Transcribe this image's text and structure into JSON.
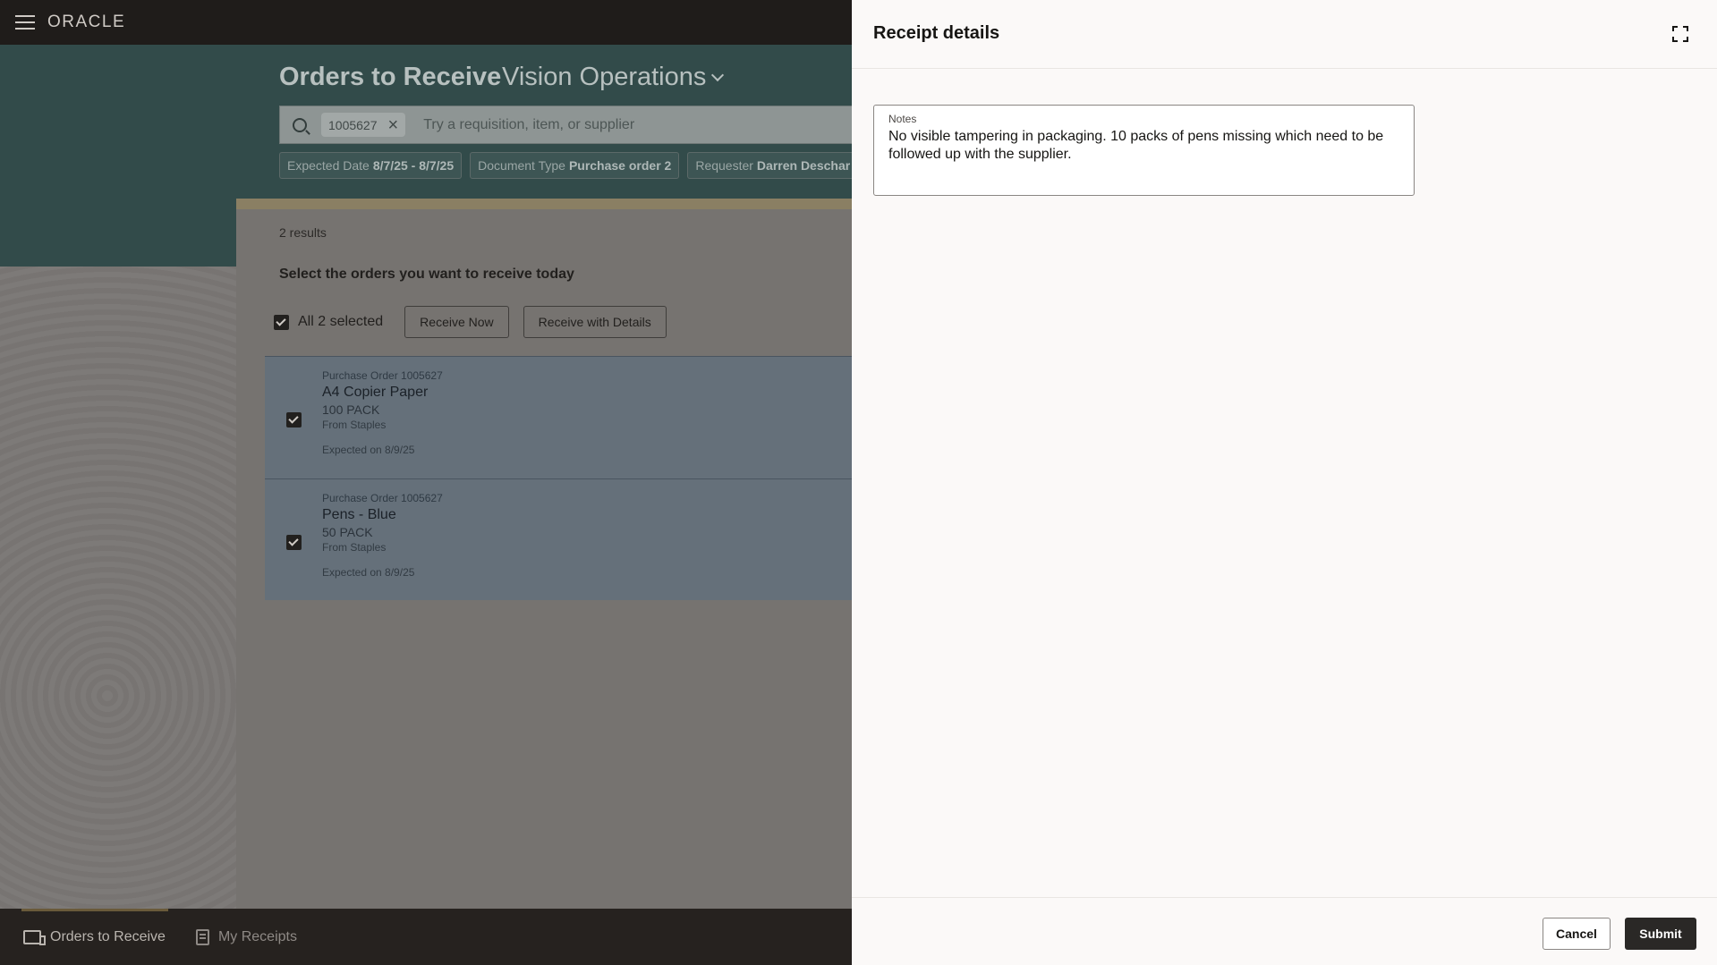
{
  "app": {
    "logo": "ORACLE",
    "page_title": "Orders to Receive",
    "org": "Vision Operations"
  },
  "search": {
    "chip": "1005627",
    "placeholder": "Try a requisition, item, or supplier"
  },
  "filters": [
    {
      "label": "Expected Date",
      "value": "8/7/25 - 8/7/25"
    },
    {
      "label": "Document Type",
      "value": "Purchase order  2"
    },
    {
      "label": "Requester",
      "value": "Darren Deschar"
    }
  ],
  "results": {
    "count": "2 results",
    "heading": "Select the orders you want to receive today",
    "select_all": "All 2 selected",
    "receive_now": "Receive Now",
    "receive_details": "Receive with Details"
  },
  "orders": [
    {
      "po": "Purchase Order 1005627",
      "item": "A4 Copier Paper",
      "qty": "100 PACK",
      "supplier": "From Staples",
      "expected": "Expected on 8/9/25"
    },
    {
      "po": "Purchase Order 1005627",
      "item": "Pens - Blue",
      "qty": "50 PACK",
      "supplier": "From Staples",
      "expected": "Expected on 8/9/25"
    }
  ],
  "nav": {
    "orders": "Orders to Receive",
    "receipts": "My Receipts"
  },
  "drawer": {
    "title": "Receipt details",
    "notes_label": "Notes",
    "notes_value": "No visible tampering in packaging. 10 packs of pens missing which need to be followed up with the supplier.",
    "cancel": "Cancel",
    "submit": "Submit"
  }
}
